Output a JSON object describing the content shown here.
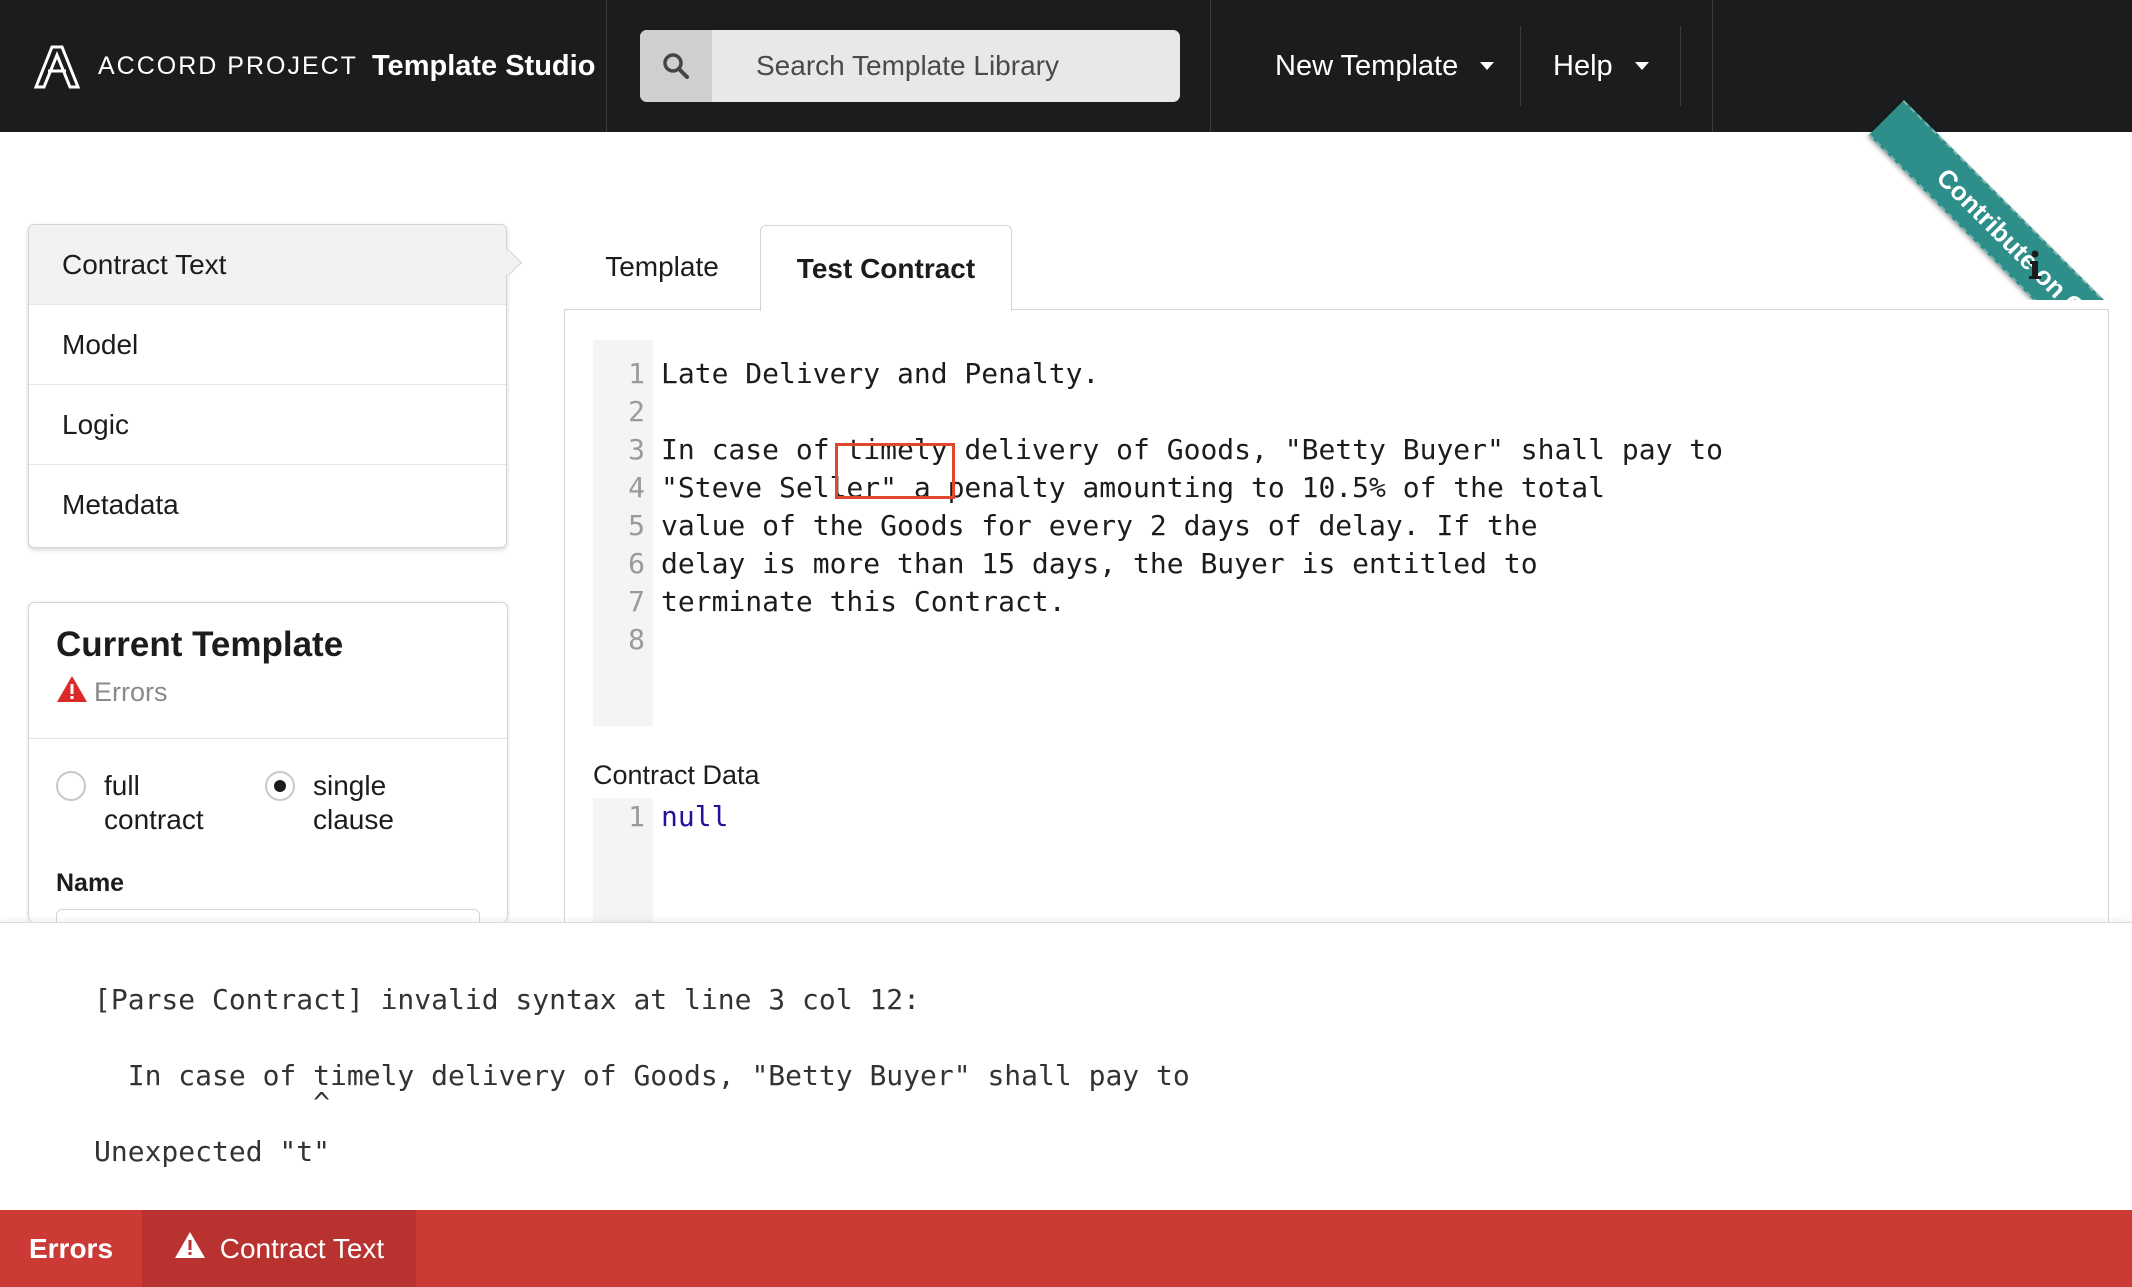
{
  "header": {
    "brand_name": "ACCORD PROJECT",
    "app_title": "Template Studio",
    "search": {
      "placeholder": "Search Template Library"
    },
    "menus": [
      {
        "label": "New Template"
      },
      {
        "label": "Help"
      }
    ],
    "ribbon": "Contribute on GitHub"
  },
  "sidebar": {
    "items": [
      {
        "label": "Contract Text",
        "active": true
      },
      {
        "label": "Model"
      },
      {
        "label": "Logic"
      },
      {
        "label": "Metadata"
      }
    ],
    "current_template": {
      "title": "Current Template",
      "status": "Errors",
      "options": [
        {
          "label": "full contract",
          "selected": false
        },
        {
          "label": "single clause",
          "selected": true
        }
      ],
      "name_label": "Name"
    }
  },
  "tabs": [
    {
      "label": "Template",
      "active": false
    },
    {
      "label": "Test Contract",
      "active": true
    }
  ],
  "editor": {
    "line_numbers": [
      "1",
      "2",
      "3",
      "4",
      "5",
      "6",
      "7",
      "8"
    ],
    "lines": [
      "Late Delivery and Penalty.",
      "",
      "In case of timely delivery of Goods, \"Betty Buyer\" shall pay to",
      "\"Steve Seller\" a penalty amounting to 10.5% of the total",
      "value of the Goods for every 2 days of delay. If the",
      "delay is more than 15 days, the Buyer is entitled to",
      "terminate this Contract.",
      ""
    ]
  },
  "contract_data": {
    "label": "Contract Data",
    "line_numbers": [
      "1"
    ],
    "value": "null"
  },
  "error_panel": {
    "lines": [
      "[Parse Contract] invalid syntax at line 3 col 12:",
      "  In case of timely delivery of Goods, \"Betty Buyer\" shall pay to",
      "             ^",
      "Unexpected \"t\""
    ]
  },
  "bottom_bar": {
    "errors_label": "Errors",
    "tab_label": "Contract Text"
  },
  "colors": {
    "nav_bg": "#1b1c1d",
    "error_red": "#cc3a36",
    "ribbon_teal": "#2d8e8a",
    "highlight": "#e0482d"
  },
  "icons": [
    "accord-logo-icon",
    "search-icon",
    "caret-down-icon",
    "info-icon",
    "warning-icon"
  ]
}
